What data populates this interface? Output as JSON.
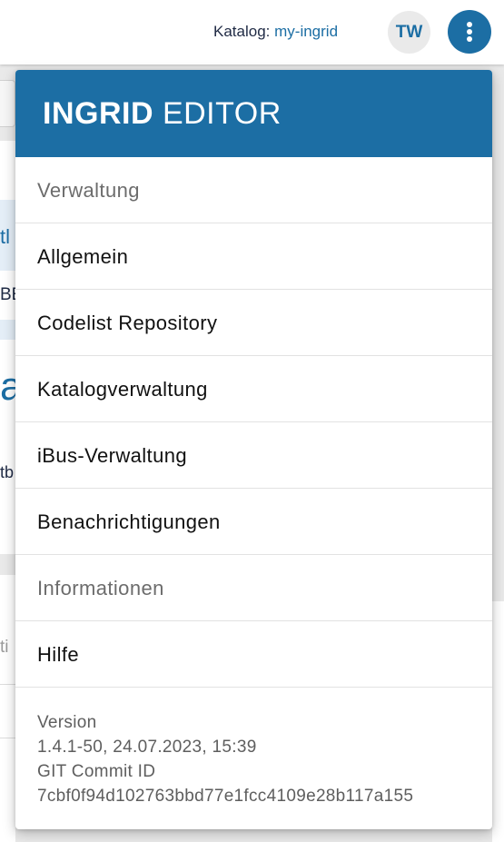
{
  "topbar": {
    "catalog_label": "Katalog:",
    "catalog_value": "my-ingrid",
    "avatar_initials": "TW",
    "menu_icon": "more-vert-icon"
  },
  "background": {
    "fragment_1": "tl",
    "fragment_2": "BE",
    "fragment_3": "a",
    "fragment_4": "tb",
    "fragment_5": "ti"
  },
  "menu": {
    "title_bold": "INGRID",
    "title_rest": "EDITOR",
    "sections": {
      "admin": "Verwaltung",
      "info": "Informationen"
    },
    "items": [
      "Allgemein",
      "Codelist Repository",
      "Katalogverwaltung",
      "iBus-Verwaltung",
      "Benachrichtigungen"
    ],
    "help": "Hilfe",
    "version": {
      "label": "Version",
      "value": "1.4.1-50, 24.07.2023, 15:39",
      "commit_label": "GIT Commit ID",
      "commit_value": "7cbf0f94d102763bbd77e1fcc4109e28b117a155"
    }
  },
  "colors": {
    "brand": "#1c6ea4",
    "header_text": "#ffffff",
    "section_text": "#6c6c6c"
  }
}
